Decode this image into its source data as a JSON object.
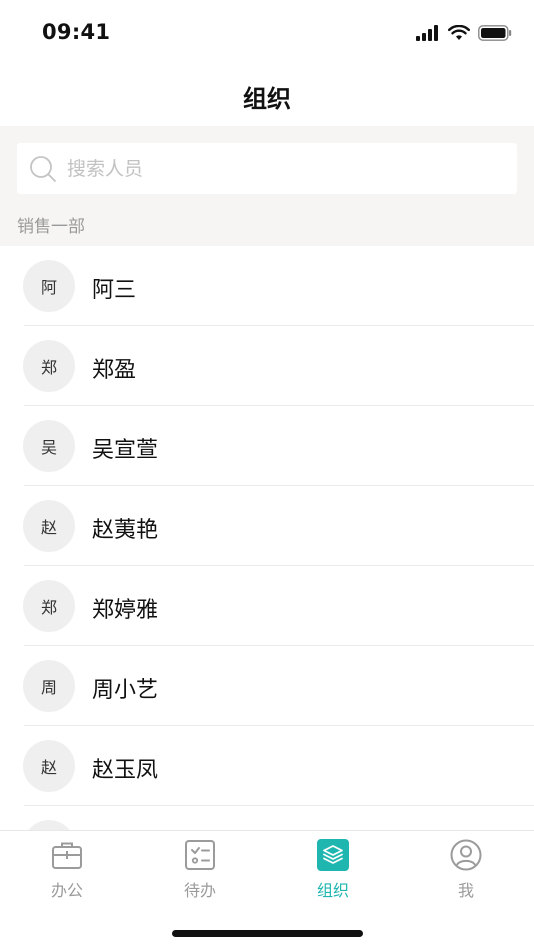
{
  "status_bar": {
    "time": "09:41"
  },
  "nav": {
    "title": "组织"
  },
  "search": {
    "placeholder": "搜索人员",
    "value": ""
  },
  "department": {
    "label": "销售一部"
  },
  "contacts": [
    {
      "avatar": "阿",
      "name": "阿三"
    },
    {
      "avatar": "郑",
      "name": "郑盈"
    },
    {
      "avatar": "吴",
      "name": "吴宣萱"
    },
    {
      "avatar": "赵",
      "name": "赵荑艳"
    },
    {
      "avatar": "郑",
      "name": "郑婷雅"
    },
    {
      "avatar": "周",
      "name": "周小艺"
    },
    {
      "avatar": "赵",
      "name": "赵玉凤"
    },
    {
      "avatar": "",
      "name": ""
    }
  ],
  "tabs": [
    {
      "label": "办公",
      "icon": "briefcase-icon",
      "active": false
    },
    {
      "label": "待办",
      "icon": "checklist-icon",
      "active": false
    },
    {
      "label": "组织",
      "icon": "layers-icon",
      "active": true
    },
    {
      "label": "我",
      "icon": "user-icon",
      "active": false
    }
  ],
  "colors": {
    "accent": "#1fb6b0",
    "inactive": "#9b9b9b",
    "search_bg": "#f6f5f3",
    "avatar_bg": "#efefef"
  }
}
